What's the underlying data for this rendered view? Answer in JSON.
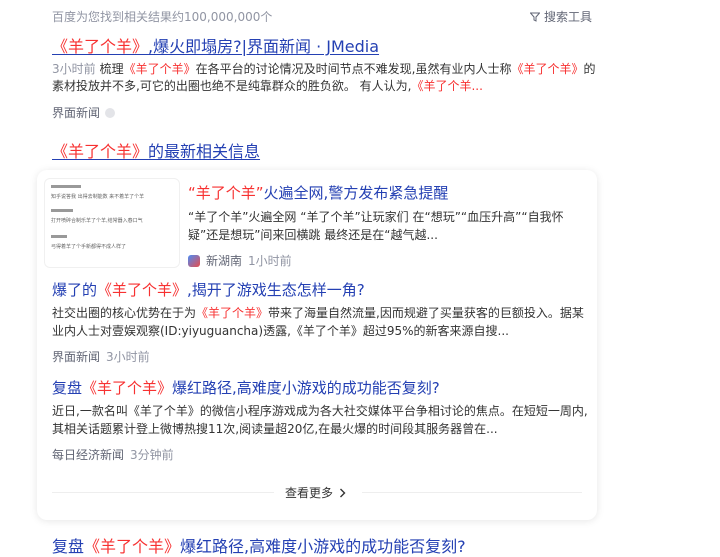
{
  "topbar": {
    "result_count": "百度为您找到相关结果约100,000,000个",
    "search_tools_label": "搜索工具",
    "search_tools_icon": "filter-icon"
  },
  "result1": {
    "title_highlight": "《羊了个羊》",
    "title_rest": ",爆火即塌房?|界面新闻 · JMedia",
    "time": "3小时前",
    "snippet_part1": "梳理",
    "snippet_hl1": "《羊了个羊》",
    "snippet_part2": "在各平台的讨论情况及时间节点不难发现,虽然有业内人士称",
    "snippet_hl2": "《羊了个羊》",
    "snippet_part3": "的素材投放并不多,可它的出圈也绝不是纯靠群众的胜负欲。 有人认为,",
    "snippet_hl3": "《羊了个羊...",
    "source": "界面新闻"
  },
  "news_section": {
    "heading_highlight": "《羊了个羊》",
    "heading_rest": "的最新相关信息",
    "thumb_lines": [
      "知乎说答我 出得去制能数 来不着羊了个羊",
      "打开喷碎合制乐羊了个羊,结常器入春口气",
      "弓得着羊了个手新都得不成人样了"
    ],
    "items": [
      {
        "title_quote": "“羊了个羊”",
        "title_rest": "火遍全网,警方发布紧急提醒",
        "text": "“羊了个羊”火遍全网 “羊了个羊”让玩家们 在“想玩”“血压升高”“自我怀疑”还是想玩”间来回横跳 最终还是在“越气越...",
        "source": "新湖南",
        "time": "1小时前"
      },
      {
        "title_pre": "爆了的",
        "title_hl": "《羊了个羊》",
        "title_rest": ",揭开了游戏生态怎样一角?",
        "text_pre": "社交出圈的核心优势在于为",
        "text_hl": "《羊了个羊》",
        "text_rest": "带来了海量自然流量,因而规避了买量获客的巨额投入。据某业内人士对壹娱观察(ID:yiyuguancha)透露,《羊了个羊》超过95%的新客来源自搜...",
        "source": "界面新闻",
        "time": "3小时前"
      },
      {
        "title_pre": "复盘",
        "title_hl": "《羊了个羊》",
        "title_rest": "爆红路径,高难度小游戏的成功能否复刻?",
        "text": "近日,一款名叫《羊了个羊》的微信小程序游戏成为各大社交媒体平台争相讨论的焦点。在短短一周内,其相关话题累计登上微博热搜11次,阅读量超20亿,在最火爆的时间段其服务器曾在...",
        "source": "每日经济新闻",
        "time": "3分钟前"
      }
    ],
    "more_label": "查看更多",
    "more_icon": "chevron-right-icon"
  },
  "cut_off_result": {
    "title_pre": "复盘",
    "title_hl": "《羊了个羊》",
    "title_rest": "爆红路径,高难度小游戏的成功能否复刻?"
  }
}
